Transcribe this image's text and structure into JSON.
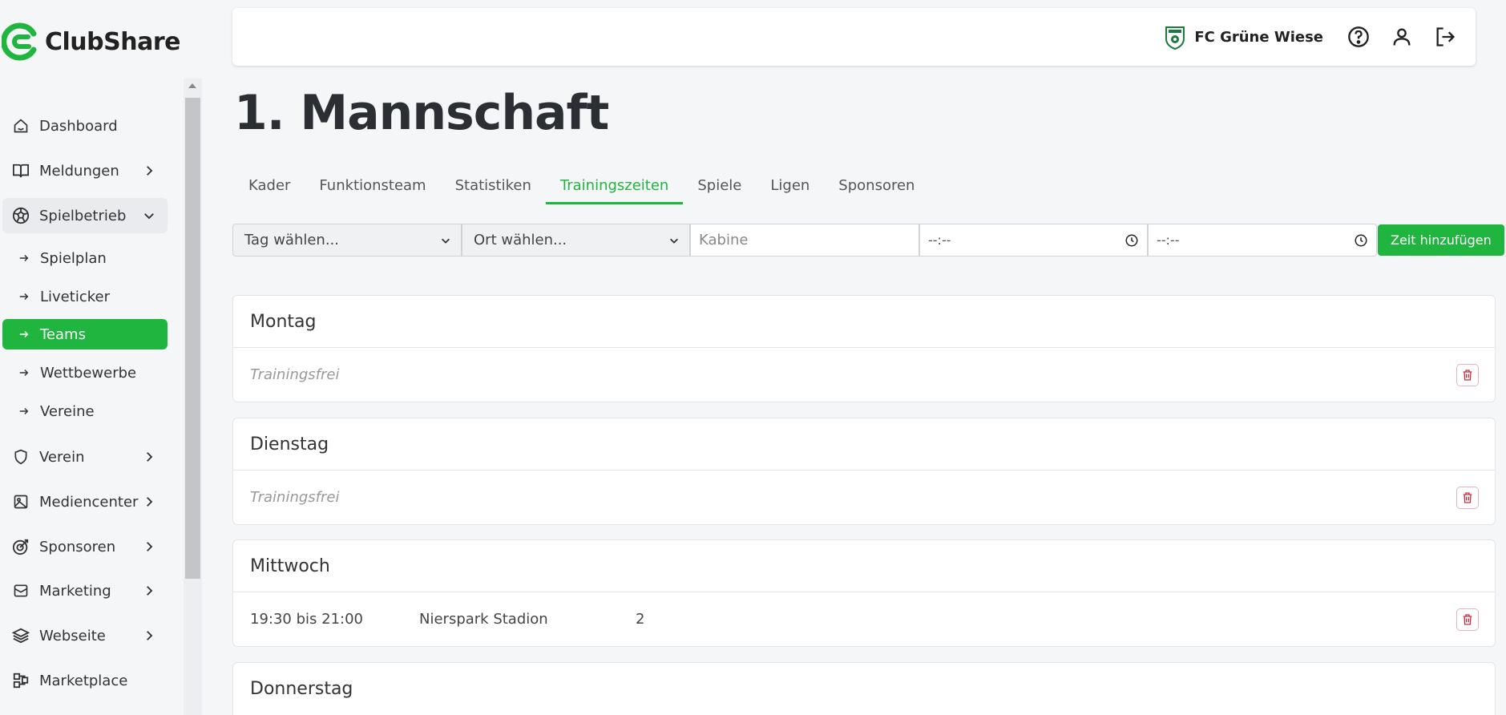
{
  "app": {
    "name": "ClubShare",
    "brand_color": "#1fb53e"
  },
  "header": {
    "club_name": "FC Grüne Wiese"
  },
  "sidebar": {
    "items": [
      {
        "label": "Dashboard",
        "icon": "home-icon"
      },
      {
        "label": "Meldungen",
        "icon": "book-icon",
        "expandable": true
      },
      {
        "label": "Spielbetrieb",
        "icon": "soccer-ball-icon",
        "expanded": true
      },
      {
        "label": "Verein",
        "icon": "shield-icon",
        "expandable": true
      },
      {
        "label": "Mediencenter",
        "icon": "image-icon",
        "expandable": true
      },
      {
        "label": "Sponsoren",
        "icon": "target-icon",
        "expandable": true
      },
      {
        "label": "Marketing",
        "icon": "mail-icon",
        "expandable": true
      },
      {
        "label": "Webseite",
        "icon": "layers-icon",
        "expandable": true
      },
      {
        "label": "Marketplace",
        "icon": "grid-icon"
      }
    ],
    "subitems": [
      {
        "label": "Spielplan"
      },
      {
        "label": "Liveticker"
      },
      {
        "label": "Teams",
        "active": true
      },
      {
        "label": "Wettbewerbe"
      },
      {
        "label": "Vereine"
      }
    ]
  },
  "page": {
    "title": "1. Mannschaft"
  },
  "tabs": [
    {
      "label": "Kader"
    },
    {
      "label": "Funktionsteam"
    },
    {
      "label": "Statistiken"
    },
    {
      "label": "Trainingszeiten",
      "active": true
    },
    {
      "label": "Spiele"
    },
    {
      "label": "Ligen"
    },
    {
      "label": "Sponsoren"
    }
  ],
  "form": {
    "day_select": "Tag wählen...",
    "location_select": "Ort wählen...",
    "cabin_placeholder": "Kabine",
    "start_time": "--:--",
    "end_time": "--:--",
    "add_button": "Zeit hinzufügen"
  },
  "days": [
    {
      "name": "Montag",
      "free_label": "Trainingsfrei"
    },
    {
      "name": "Dienstag",
      "free_label": "Trainingsfrei"
    },
    {
      "name": "Mittwoch",
      "time": "19:30 bis 21:00",
      "location": "Nierspark Stadion",
      "cabin": "2"
    },
    {
      "name": "Donnerstag"
    }
  ]
}
